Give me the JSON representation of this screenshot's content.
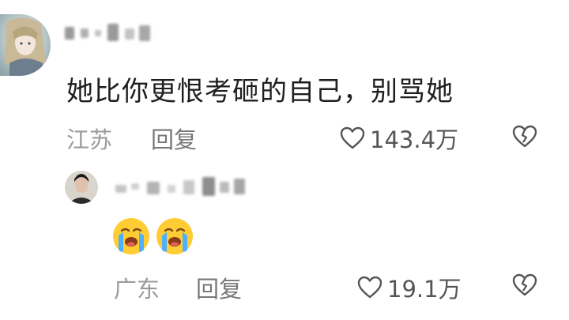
{
  "comments": [
    {
      "avatar_icon": "anime-girl-avatar",
      "text": "她比你更恨考砸的自己，别骂她",
      "location": "江苏",
      "reply_label": "回复",
      "likes": "143.4万",
      "like_icon": "heart-outline-icon",
      "dislike_icon": "broken-heart-icon"
    },
    {
      "avatar_icon": "man-portrait-avatar",
      "emojis": [
        "loudly-crying-face",
        "loudly-crying-face"
      ],
      "location": "广东",
      "reply_label": "回复",
      "likes": "19.1万",
      "like_icon": "heart-outline-icon",
      "dislike_icon": "broken-heart-icon"
    }
  ],
  "colors": {
    "text": "#1f1f1f",
    "meta": "#9b9b9b",
    "icon": "#555555"
  }
}
